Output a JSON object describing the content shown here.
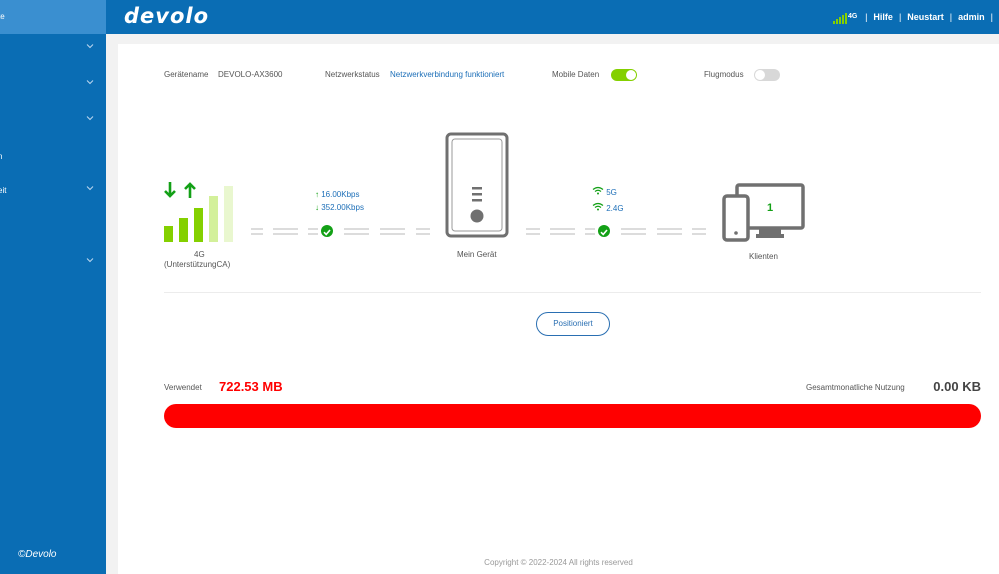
{
  "sidebar": {
    "items": [
      {
        "label": "te",
        "chevron": false,
        "active": true
      },
      {
        "label": "",
        "chevron": true
      },
      {
        "label": "",
        "chevron": true
      },
      {
        "label": "",
        "chevron": true
      },
      {
        "label": "n",
        "chevron": false
      },
      {
        "label": "eit",
        "chevron": true
      },
      {
        "label": "",
        "chevron": false
      },
      {
        "label": "",
        "chevron": true
      }
    ],
    "copyright": "©Devolo"
  },
  "header": {
    "logo": "devolo",
    "network_badge": "4G",
    "links": [
      "Hilfe",
      "Neustart",
      "admin"
    ]
  },
  "status": {
    "device_name_label": "Gerätename",
    "device_name_value": "DEVOLO-AX3600",
    "network_status_label": "Netzwerkstatus",
    "network_status_value": "Netzwerkverbindung funktioniert",
    "mobile_data_label": "Mobile Daten",
    "mobile_data_on": true,
    "flight_mode_label": "Flugmodus",
    "flight_mode_on": false
  },
  "topology": {
    "network_type": "4G",
    "network_sub": "(UnterstützungCA)",
    "upload": "16.00Kbps",
    "download": "352.00Kbps",
    "device_label": "Mein Gerät",
    "wifi_bands": [
      "5G",
      "2.4G"
    ],
    "clients_count": "1",
    "clients_label": "Klienten"
  },
  "position_button": "Positioniert",
  "usage": {
    "used_label": "Verwendet",
    "used_value": "722.53 MB",
    "total_label": "Gesamtmonatliche Nutzung",
    "total_value": "0.00 KB"
  },
  "footer": "Copyright © 2022-2024 All rights reserved",
  "colors": {
    "primary": "#0a6db4",
    "accent_green": "#84d000",
    "check_green": "#13a016",
    "usage_red": "#ff0000"
  }
}
